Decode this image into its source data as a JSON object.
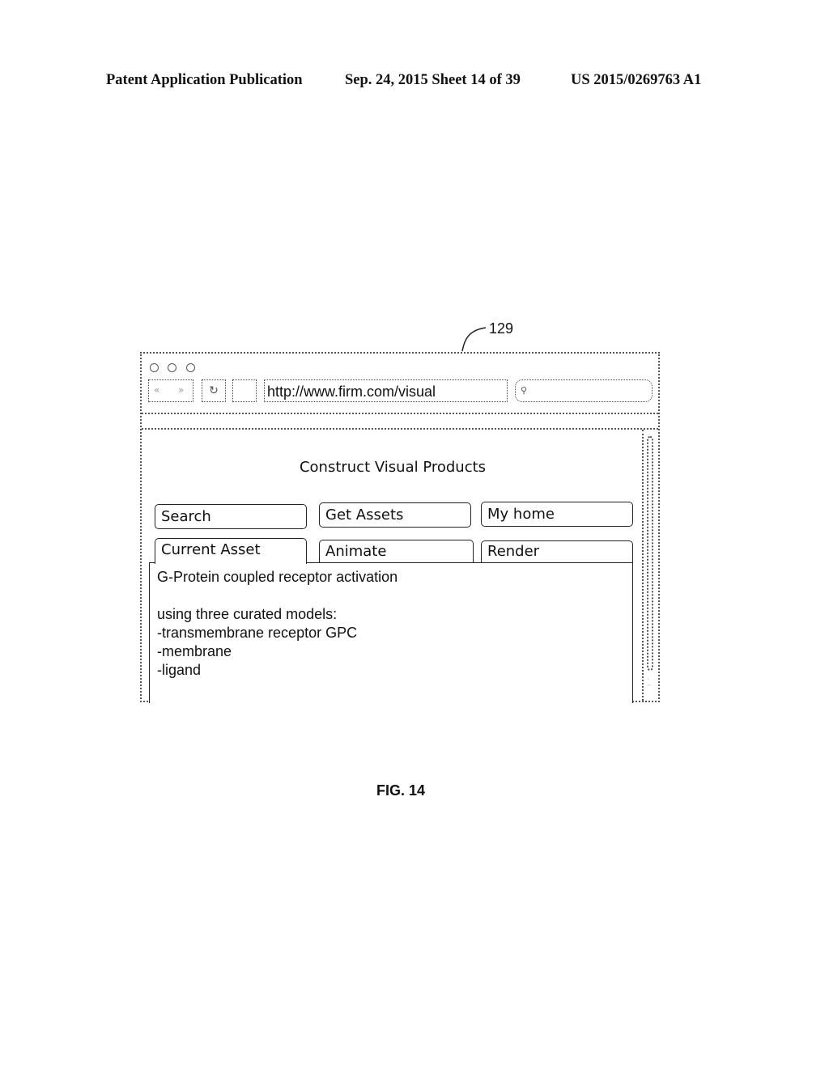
{
  "header": {
    "left": "Patent Application Publication",
    "middle": "Sep. 24, 2015   Sheet 14 of 39",
    "right": "US 2015/0269763 A1"
  },
  "reference_numeral": "129",
  "browser": {
    "window_controls": [
      "close-dot",
      "minimize-dot",
      "maximize-dot"
    ],
    "back_icon": "«",
    "forward_icon": "»",
    "reload_icon": "↻",
    "url": "http://www.firm.com/visual",
    "search_icon": "⚲",
    "search_value": ""
  },
  "page": {
    "title": "Construct Visual Products",
    "buttons": [
      {
        "label": "Search"
      },
      {
        "label": "Get Assets"
      },
      {
        "label": "My home"
      }
    ],
    "tabs": [
      {
        "label": "Current Asset",
        "active": true
      },
      {
        "label": "Animate",
        "active": false
      },
      {
        "label": "Render",
        "active": false
      }
    ],
    "content_lines": [
      "G-Protein coupled receptor activation",
      "",
      "using three curated models:",
      "-transmembrane receptor GPC",
      "-membrane",
      "-ligand"
    ]
  },
  "figure_label": "FIG. 14"
}
